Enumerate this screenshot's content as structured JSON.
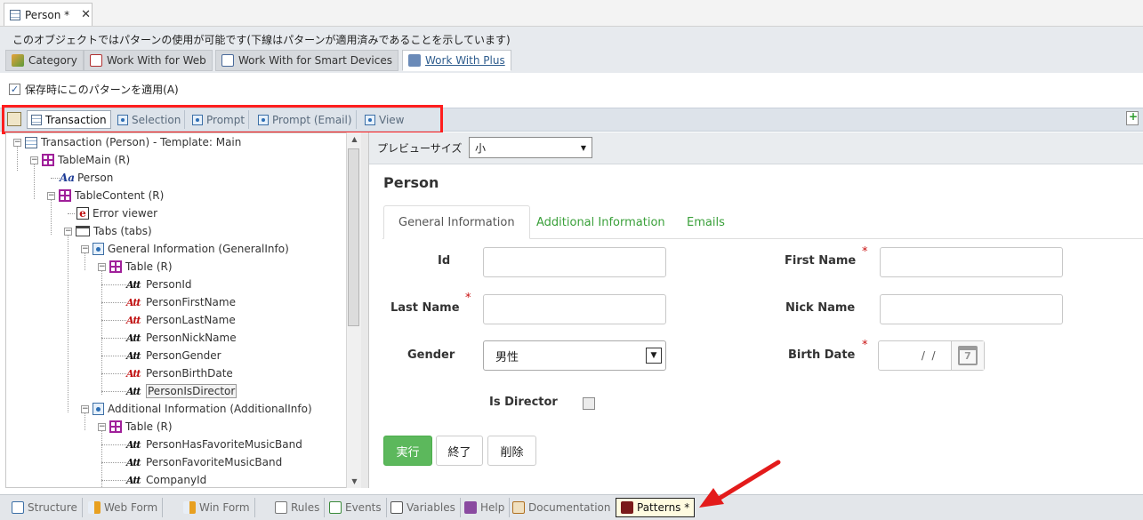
{
  "document_tab": {
    "label": "Person *",
    "close": "✕"
  },
  "pattern_header": {
    "description": "このオブジェクトではパターンの使用が可能です(下線はパターンが適用済みであることを示しています)",
    "tabs": [
      "Category",
      "Work With for Web",
      "Work With for Smart Devices",
      "Work With Plus"
    ],
    "active_tab": "Work With Plus"
  },
  "apply_checkbox": {
    "label": "保存時にこのパターンを適用(A)",
    "checked": true,
    "mark": "✓"
  },
  "instance_tabs": [
    "Transaction",
    "Selection",
    "Prompt",
    "Prompt (Email)",
    "View"
  ],
  "tree": {
    "nodes": [
      "Transaction (Person) - Template: Main",
      "TableMain (R)",
      "Person",
      "TableContent (R)",
      "Error viewer",
      "Tabs (tabs)",
      "General Information (GeneralInfo)",
      "Table (R)",
      "PersonId",
      "PersonFirstName",
      "PersonLastName",
      "PersonNickName",
      "PersonGender",
      "PersonBirthDate",
      "PersonIsDirector",
      "Additional Information (AdditionalInfo)",
      "Table (R)",
      "PersonHasFavoriteMusicBand",
      "PersonFavoriteMusicBand",
      "CompanyId"
    ],
    "selected": "PersonIsDirector"
  },
  "preview": {
    "size_label": "プレビューサイズ",
    "size_value": "小",
    "form_title": "Person",
    "tabs": [
      "General Information",
      "Additional Information",
      "Emails"
    ],
    "fields": {
      "id": "Id",
      "first_name": "First Name",
      "last_name": "Last Name",
      "nick_name": "Nick Name",
      "gender": "Gender",
      "gender_value": "男性",
      "birth_date": "Birth Date",
      "birth_date_value": " /  /",
      "is_director": "Is Director",
      "calendar_day": "7"
    },
    "required_mark": "*",
    "buttons": {
      "confirm": "実行",
      "close": "終了",
      "delete": "削除"
    }
  },
  "bottom_tabs": [
    "Structure",
    "Web Form",
    "Win Form",
    "Rules",
    "Events",
    "Variables",
    "Help",
    "Documentation",
    "Patterns *"
  ],
  "active_bottom_tab": "Patterns *",
  "colors": {
    "highlight": "#ff1e1e",
    "arrow": "#e31b1b",
    "primary_button": "#5cb85c",
    "link_tab": "#3aa03a"
  }
}
